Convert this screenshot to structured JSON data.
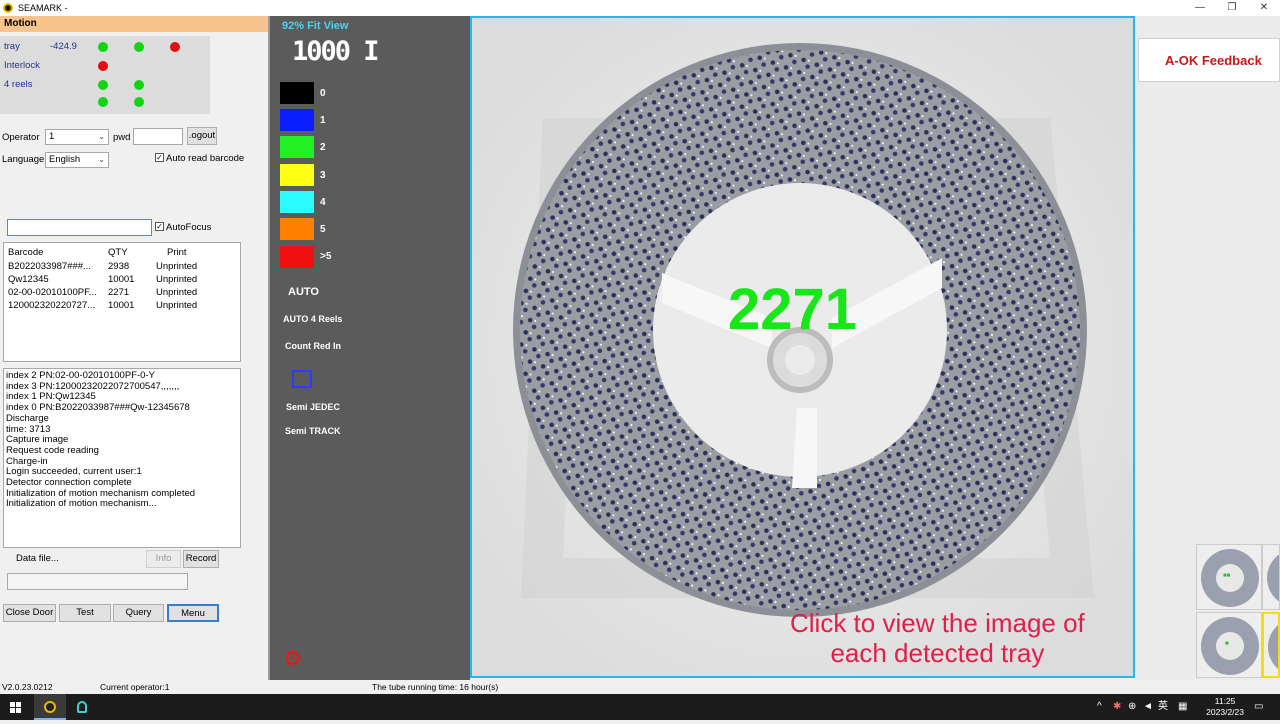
{
  "window": {
    "title": "SEAMARK -",
    "minimize": "—",
    "restore": "❐",
    "close": "✕"
  },
  "motion": {
    "header": "Motion",
    "rows": [
      {
        "label": "tray",
        "value": "-424.9"
      },
      {
        "label": "Interlock",
        "value": ""
      },
      {
        "label": "4 reels",
        "value": ""
      }
    ],
    "colors": {
      "green": "#13d413",
      "red": "#e01010"
    }
  },
  "login": {
    "operator_label": "Operator",
    "operator_value": "1",
    "pwd_label": "pwd",
    "pwd_value": "",
    "logout_label": ".ogout",
    "language_label": "Language",
    "language_value": "English",
    "auto_read_label": "Auto read barcode",
    "auto_read_checked": "✓"
  },
  "barcode_input": {
    "value": "",
    "autofocus_label": "AutoFocus",
    "autofocus_checked": "✓"
  },
  "list": {
    "headers": [
      "Barcode",
      "QTY",
      "Print"
    ],
    "rows": [
      [
        "B2022033987###...",
        "2938",
        "Unprinted"
      ],
      [
        "Qw12345",
        "10001",
        "Unprinted"
      ],
      [
        "02-00-02010100PF...",
        "2271",
        "Unprinted"
      ],
      [
        "120002320220727...",
        "10001",
        "Unprinted"
      ]
    ]
  },
  "log": [
    "index 2 PN:02-00-02010100PF-0-Y",
    "index 3 PN:12000232022072700547,,,,,,,",
    "index 1 PN:Qw12345",
    "index 0 PN:B2022033987###Qw-12345678",
    "Discharge",
    "time: 3713",
    "Capture image",
    "Request code reading",
    "Charge-in",
    "Login succeeded, current user:1",
    "Detector connection complete",
    "Initialization of motion mechanism completed",
    "Initialization of motion mechanism..."
  ],
  "data_file": {
    "label": "Data file...",
    "info_label": "Info",
    "record_label": "Record",
    "path_value": ""
  },
  "buttons": {
    "close_door": "Close Door",
    "test": "Test",
    "query": "Query",
    "menu": "Menu"
  },
  "status": {
    "version": "V2.0.23.0212",
    "current_operator": "Current operator:1",
    "tube_time": "The tube running time: 16 hour(s)"
  },
  "viewer": {
    "fit_label": "92% Fit View",
    "led_value": "1000 I",
    "legend": [
      {
        "label": "0",
        "color": "#000000"
      },
      {
        "label": "1",
        "color": "#0a1fff"
      },
      {
        "label": "2",
        "color": "#22f022"
      },
      {
        "label": "3",
        "color": "#ffff14"
      },
      {
        "label": "4",
        "color": "#2cfbff"
      },
      {
        "label": "5",
        "color": "#ff8000"
      },
      {
        "label": ">5",
        "color": "#f01010"
      }
    ],
    "modes": {
      "auto": "AUTO",
      "auto_4_reels": "AUTO 4 Reels",
      "count_red_in": "Count Red In",
      "semi_jedec": "Semi JEDEC",
      "semi_track": "Semi TRACK"
    },
    "count": "2271",
    "caption_line1": "Click to view the image of",
    "caption_line2": "each detected tray"
  },
  "right": {
    "feedback": "A-OK Feedback"
  },
  "taskbar": {
    "ime": "英",
    "time": "11:25",
    "date": "2023/2/23"
  }
}
